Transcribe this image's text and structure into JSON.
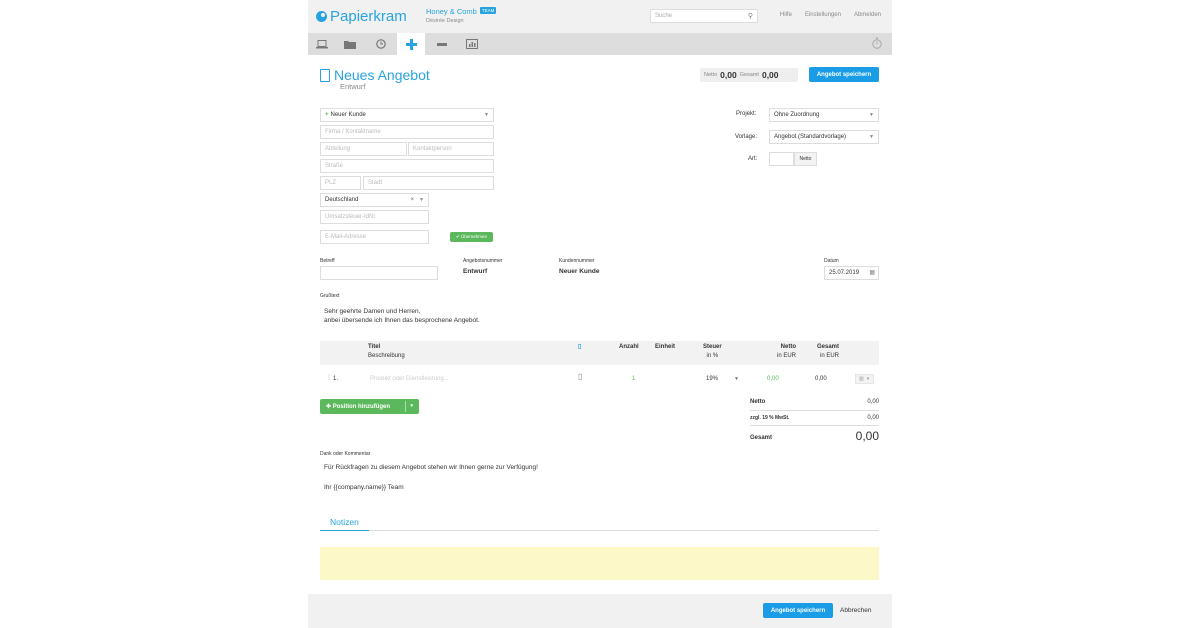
{
  "app": {
    "brand": "Papierkram",
    "accent": "#29a3df"
  },
  "company": {
    "name": "Honey & Comb",
    "badge": "TEAM",
    "sub": "Désirée Design"
  },
  "search": {
    "placeholder": "Suche"
  },
  "toplinks": {
    "help": "Hilfe",
    "settings": "Einstellungen",
    "logout": "Abmelden"
  },
  "nav": {
    "icons": [
      "laptop-icon",
      "folder-icon",
      "clock-icon",
      "plus-icon",
      "minus-icon",
      "chart-icon"
    ],
    "right_icon": "stopwatch-icon"
  },
  "page": {
    "title": "Neues Angebot",
    "subtitle": "Entwurf"
  },
  "totals": {
    "netto_label": "Netto",
    "netto_value": "0,00",
    "gesamt_label": "Gesamt",
    "gesamt_value": "0,00"
  },
  "buttons": {
    "save": "Angebot speichern",
    "cancel": "Abbrechen",
    "apply": "✔ Übernehmen",
    "add_position": "Position hinzufügen"
  },
  "customer": {
    "select": "Neuer Kunde",
    "company_ph": "Firma / Kontaktname",
    "department_ph": "Abteilung",
    "contact_ph": "Kontaktperson",
    "street_ph": "Straße",
    "zip_ph": "PLZ",
    "city_ph": "Stadt",
    "country": "Deutschland",
    "vat_ph": "Umsatzsteuer-IdNr.",
    "email_ph": "E-Mail-Adresse"
  },
  "right_form": {
    "project_label": "Projekt:",
    "project_value": "Ohne Zuordnung",
    "template_label": "Vorlage:",
    "template_value": "Angebot (Standardvorlage)",
    "type_label": "Art:",
    "type_value": "Netto"
  },
  "meta": {
    "subject_label": "Betreff",
    "offer_no_label": "Angebotsnummer",
    "offer_no_value": "Entwurf",
    "customer_no_label": "Kundennummer",
    "customer_no_value": "Neuer Kunde",
    "date_label": "Datum",
    "date_value": "25.07.2019"
  },
  "greeting": {
    "label": "Grußtext",
    "line1": "Sehr geehrte Damen und Herren,",
    "line2": "anbei übersende ich Ihnen das besprochene Angebot."
  },
  "table": {
    "headers": {
      "title": "Titel",
      "description": "Beschreibung",
      "qty": "Anzahl",
      "unit": "Einheit",
      "tax": "Steuer",
      "tax_sub": "in %",
      "net": "Netto",
      "net_sub": "in EUR",
      "total": "Gesamt",
      "total_sub": "in EUR"
    },
    "row": {
      "index": "1.",
      "placeholder": "Produkt oder Dienstleistung...",
      "qty": "1",
      "tax": "19%",
      "net": "0,00",
      "total": "0,00"
    }
  },
  "summary": {
    "net_label": "Netto",
    "net_value": "0,00",
    "vat_label": "zzgl. 19 % MwSt.",
    "vat_value": "0,00",
    "total_label": "Gesamt",
    "total_value": "0,00"
  },
  "comment": {
    "label": "Dank oder Kommentar",
    "line1": "Für Rückfragen zu diesem Angebot stehen wir Ihnen gerne zur Verfügung!",
    "line2": "Ihr {{company.name}} Team"
  },
  "tabs": {
    "notes": "Notizen"
  }
}
